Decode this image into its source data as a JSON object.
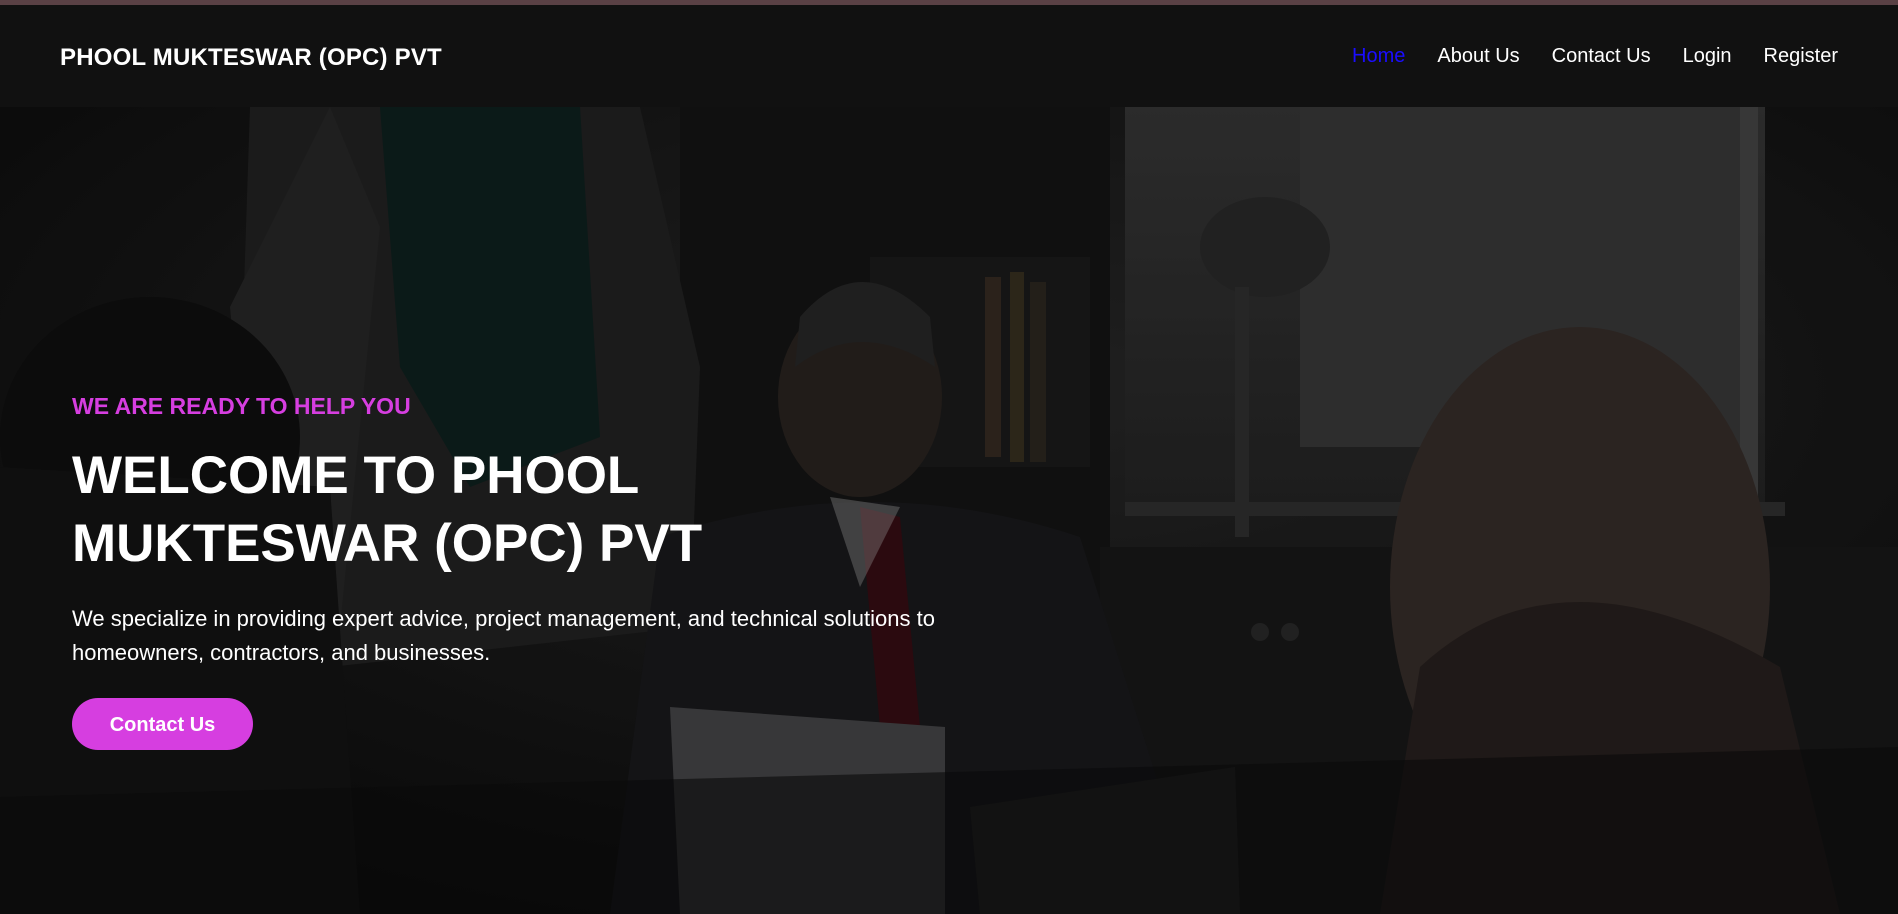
{
  "nav": {
    "brand": "PHOOL MUKTESWAR (OPC) PVT",
    "links": [
      {
        "label": "Home",
        "active": true
      },
      {
        "label": "About Us",
        "active": false
      },
      {
        "label": "Contact Us",
        "active": false
      },
      {
        "label": "Login",
        "active": false
      },
      {
        "label": "Register",
        "active": false
      }
    ]
  },
  "hero": {
    "eyebrow": "WE ARE READY TO HELP YOU",
    "headline": "WELCOME TO PHOOL MUKTESWAR (OPC) PVT",
    "description": "We specialize in providing expert advice, project management, and technical solutions to homeowners, contractors, and businesses.",
    "cta_label": "Contact Us",
    "background_image": "dimmed office meeting photo"
  },
  "colors": {
    "accent": "#d63ee0",
    "nav_active": "#1a0dff",
    "nav_bg": "#111111",
    "text": "#ffffff"
  }
}
